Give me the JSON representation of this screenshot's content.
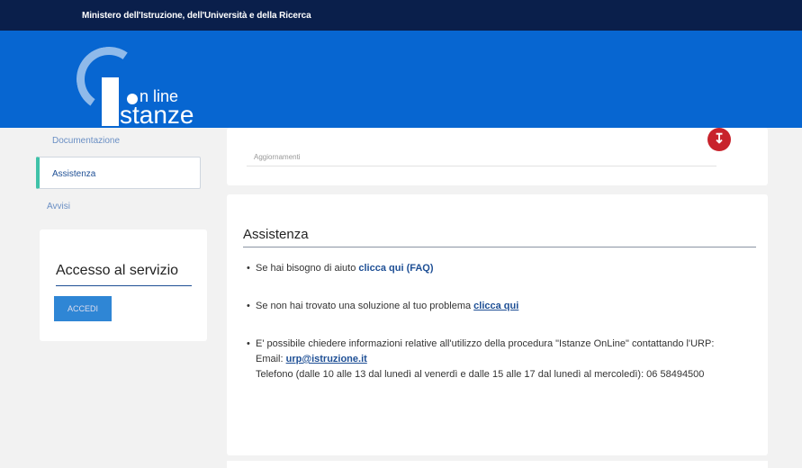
{
  "topbar": {
    "ministry": "Ministero dell'Istruzione, dell'Università e della Ricerca"
  },
  "logo": {
    "line1": "n line",
    "line2": "stanze"
  },
  "sidebar": {
    "items": [
      {
        "label": "Documentazione"
      },
      {
        "label": "Assistenza",
        "active": true
      },
      {
        "label": "Avvisi"
      }
    ],
    "access": {
      "title": "Accesso al servizio",
      "button": "ACCEDI"
    }
  },
  "updates": {
    "label": "Aggiornamenti"
  },
  "assistenza": {
    "title": "Assistenza",
    "item1": {
      "text": "Se hai bisogno di aiuto ",
      "link": "clicca qui (FAQ)"
    },
    "item2": {
      "text": "Se non hai trovato una soluzione al tuo problema ",
      "link": "clicca qui"
    },
    "item3": {
      "text1": "E' possibile chiedere informazioni relative all'utilizzo della procedura \"Istanze OnLine\" contattando l'URP:",
      "email_label": "Email: ",
      "email": "urp@istruzione.it",
      "phone": "Telefono (dalle 10 alle 13 dal lunedì al venerdì e dalle 15 alle 17 dal lunedì al mercoledì): 06 58494500"
    }
  },
  "colors": {
    "header": "#0766d1",
    "topbar": "#0a1f4b",
    "accent": "#3fc2a8",
    "download": "#c8232c"
  }
}
